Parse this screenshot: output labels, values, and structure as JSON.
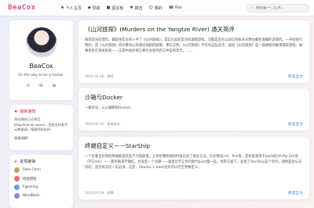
{
  "site": {
    "logo": "BeaCox"
  },
  "nav": [
    {
      "icon": "❀",
      "label": "个人主页"
    },
    {
      "icon": "◆",
      "label": "导航"
    },
    {
      "icon": "■",
      "label": "留言板"
    },
    {
      "icon": "✱",
      "label": "搏击"
    },
    {
      "icon": "☺",
      "label": "我的"
    },
    {
      "icon": "☎",
      "label": "Rss"
    }
  ],
  "search": {
    "placeholder": "搜索最一门艺术…"
  },
  "profile": {
    "name": "BeaCox",
    "bio": "On the way to be a hacker."
  },
  "announcement": {
    "title": "最新通知",
    "text": "本站域名已迁移至 blog.beacox.space，目前支持若干元数据调，感谢您的支持",
    "foot": "感谢理解!"
  },
  "friends": {
    "title": "友情链接",
    "items": [
      {
        "name": "Felix Chen",
        "color": "#c9a26b"
      },
      {
        "name": "杨源博客",
        "color": "#e07070"
      },
      {
        "name": "Fgessing",
        "color": "#6a9ce0"
      },
      {
        "name": "WindBack",
        "color": "#9a7ed8"
      }
    ]
  },
  "posts": [
    {
      "title": "《山河旅探》(Murders on the Yangtze River) 通关简评",
      "body": "统前前天的资料，都是往年对的入手了《山河旅探》，其实在此前是为快速理游戏，可能是因为以前玩到本末对我也都有准确的游理的。一开始很引我的，是《山河旅探》给水墨风以及感动理剧的剧情。事实证明，《山河旅探》不仅有这些优点。画风《山河旅探》是一款模板的推理探案游戏，故事发生在清末民初——正是中国封建王朝社会受到西方冲击的年代，……",
      "date": "2024-02-16 · 游戏",
      "read": "阅读全文"
    },
    {
      "title": "沙箱与Docker",
      "body": "一篇杂谈，从沙箱聊到Docker。",
      "date": "2023-09-10 · 系统安全",
      "read": "阅读全文"
    },
    {
      "title": "终端自定义——StarShip",
      "body": "一个好看且好用的终端能提高生产力和颜值。之前折腾终端的时候也试了很多方法，比如换成zsh、fish等，还有安装用于bash的Oh-My-Zsh等（不在zsh）——莫名删减不懂挂，总发是一个问题——速度比不让你可能代bash慢一些。找等方面下，发现了StarShip这个项目，通用是足以支持的，是否再无比一实必须，这是，Ubuntu + bash也开可以完全参数定义。",
      "date": "2023-07-29 · 折腾",
      "read": "阅读全文"
    }
  ]
}
